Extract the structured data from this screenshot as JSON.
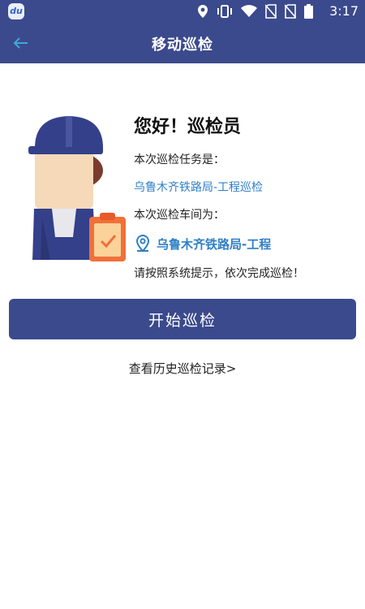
{
  "status_bar": {
    "app_badge_text": "du",
    "time": "3:17"
  },
  "app_bar": {
    "title": "移动巡检"
  },
  "main": {
    "greeting": "您好！巡检员",
    "task_label": "本次巡检任务是：",
    "task_name": "乌鲁木齐铁路局-工程巡检",
    "workshop_label": "本次巡检车间为：",
    "workshop_name": "乌鲁木齐铁路局-工程",
    "hint": "请按照系统提示，依次完成巡检！",
    "start_button": "开始巡检",
    "history_link": "查看历史巡检记录>"
  },
  "colors": {
    "primary": "#3b4a8c",
    "link": "#2f7fc8",
    "accent_orange": "#f0703a"
  },
  "icons": {
    "back": "arrow-left-icon",
    "location": "location-pin-icon",
    "clipboard": "clipboard-check-icon"
  }
}
